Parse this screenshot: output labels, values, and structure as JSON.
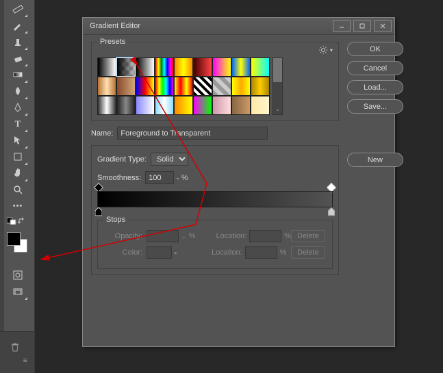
{
  "dialog": {
    "title": "Gradient Editor",
    "presets_label": "Presets",
    "name_label": "Name:",
    "name_value": "Foreground to Transparent",
    "gradient_type_label": "Gradient Type:",
    "gradient_type_value": "Solid",
    "smoothness_label": "Smoothness:",
    "smoothness_value": "100",
    "percent": "%",
    "stops_label": "Stops",
    "opacity_label": "Opacity:",
    "color_label": "Color:",
    "location_label": "Location:",
    "delete_label": "Delete"
  },
  "buttons": {
    "ok": "OK",
    "cancel": "Cancel",
    "load": "Load...",
    "save": "Save...",
    "new": "New"
  },
  "presets": [
    "linear-gradient(to right,#000,#fff)",
    "linear-gradient(to right,#000,transparent)",
    "linear-gradient(to right,#000,#fff)",
    "linear-gradient(to right,red,yellow,green,cyan,blue,magenta,red)",
    "linear-gradient(to right,#f80,#ff0,#f80)",
    "linear-gradient(to right,#400,#f44)",
    "linear-gradient(to right,#f0f,#ff0)",
    "linear-gradient(to right,#06f,#ff0,#06f)",
    "linear-gradient(to right,#ff0,#0ff)",
    "linear-gradient(to right,#b87333,#ffe0b2,#b87333)",
    "linear-gradient(to right,#8a4a2a,#d2a679)",
    "linear-gradient(to right,#00f,red,#ff0)",
    "linear-gradient(to right,red,#ff0,#0f0,#0ff,#00f,#f0f)",
    "linear-gradient(to right,#ff0,red,#ff0,red)",
    "repeating-linear-gradient(45deg,#000 0 4px,#fff 4px 8px)",
    "repeating-linear-gradient(45deg,#999 0 6px,#ccc 6px 12px)",
    "linear-gradient(to right,#ff0,#fa0,#ff0)",
    "linear-gradient(to right,#a80,#fc0,#a80)",
    "linear-gradient(to right,#333,#fff,#333)",
    "linear-gradient(to right,#222,#888,#222)",
    "linear-gradient(to right,#88f,#fff)",
    "linear-gradient(to right,#8df,#fff,#8df)",
    "linear-gradient(to right,#f80,#ff0)",
    "linear-gradient(to right,#f0f,#0f0)",
    "linear-gradient(to right,#c9a,#fdd)",
    "linear-gradient(to right,#886644,#cc9966)",
    "linear-gradient(to right,#ffeaa7,#fff5cc)"
  ]
}
